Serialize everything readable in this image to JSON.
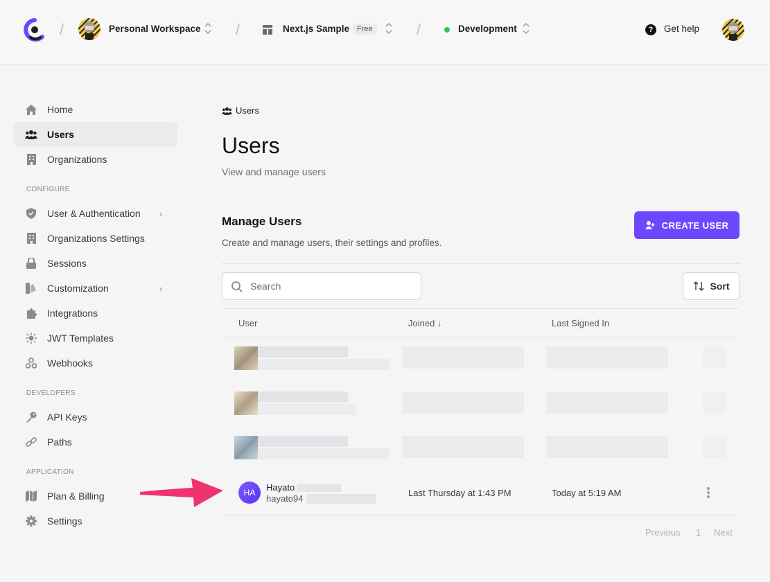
{
  "topbar": {
    "workspace": "Personal Workspace",
    "app_name": "Next.js Sample",
    "plan_badge": "Free",
    "environment": "Development",
    "help_label": "Get help"
  },
  "sidebar": {
    "main_items": [
      {
        "label": "Home",
        "icon": "home-icon"
      },
      {
        "label": "Users",
        "icon": "users-icon",
        "active": true
      },
      {
        "label": "Organizations",
        "icon": "building-icon"
      }
    ],
    "configure_label": "CONFIGURE",
    "configure_items": [
      {
        "label": "User & Authentication",
        "icon": "shield-icon",
        "has_submenu": true
      },
      {
        "label": "Organizations Settings",
        "icon": "building-icon"
      },
      {
        "label": "Sessions",
        "icon": "lock-icon"
      },
      {
        "label": "Customization",
        "icon": "paint-icon",
        "has_submenu": true
      },
      {
        "label": "Integrations",
        "icon": "puzzle-icon"
      },
      {
        "label": "JWT Templates",
        "icon": "sun-icon"
      },
      {
        "label": "Webhooks",
        "icon": "webhook-icon"
      }
    ],
    "developers_label": "DEVELOPERS",
    "developer_items": [
      {
        "label": "API Keys",
        "icon": "key-icon"
      },
      {
        "label": "Paths",
        "icon": "link-icon"
      }
    ],
    "application_label": "APPLICATION",
    "application_items": [
      {
        "label": "Plan & Billing",
        "icon": "map-icon"
      },
      {
        "label": "Settings",
        "icon": "gear-icon"
      }
    ]
  },
  "main": {
    "breadcrumb": "Users",
    "title": "Users",
    "subtitle": "View and manage users",
    "section_title": "Manage Users",
    "section_subtitle": "Create and manage users, their settings and profiles.",
    "create_button": "CREATE USER",
    "search_placeholder": "Search",
    "sort_label": "Sort",
    "columns": [
      "User",
      "Joined",
      "Last Signed In"
    ],
    "visible_user": {
      "initials": "HA",
      "name": "Hayato",
      "email": "hayato94",
      "joined": "Last Thursday at 1:43 PM",
      "last_signed_in": "Today at 5:19 AM"
    },
    "pagination": {
      "previous": "Previous",
      "page": "1",
      "next": "Next"
    }
  },
  "colors": {
    "accent": "#6c47ff",
    "annotation_arrow": "#f0336e",
    "env_dot": "#38c156"
  }
}
